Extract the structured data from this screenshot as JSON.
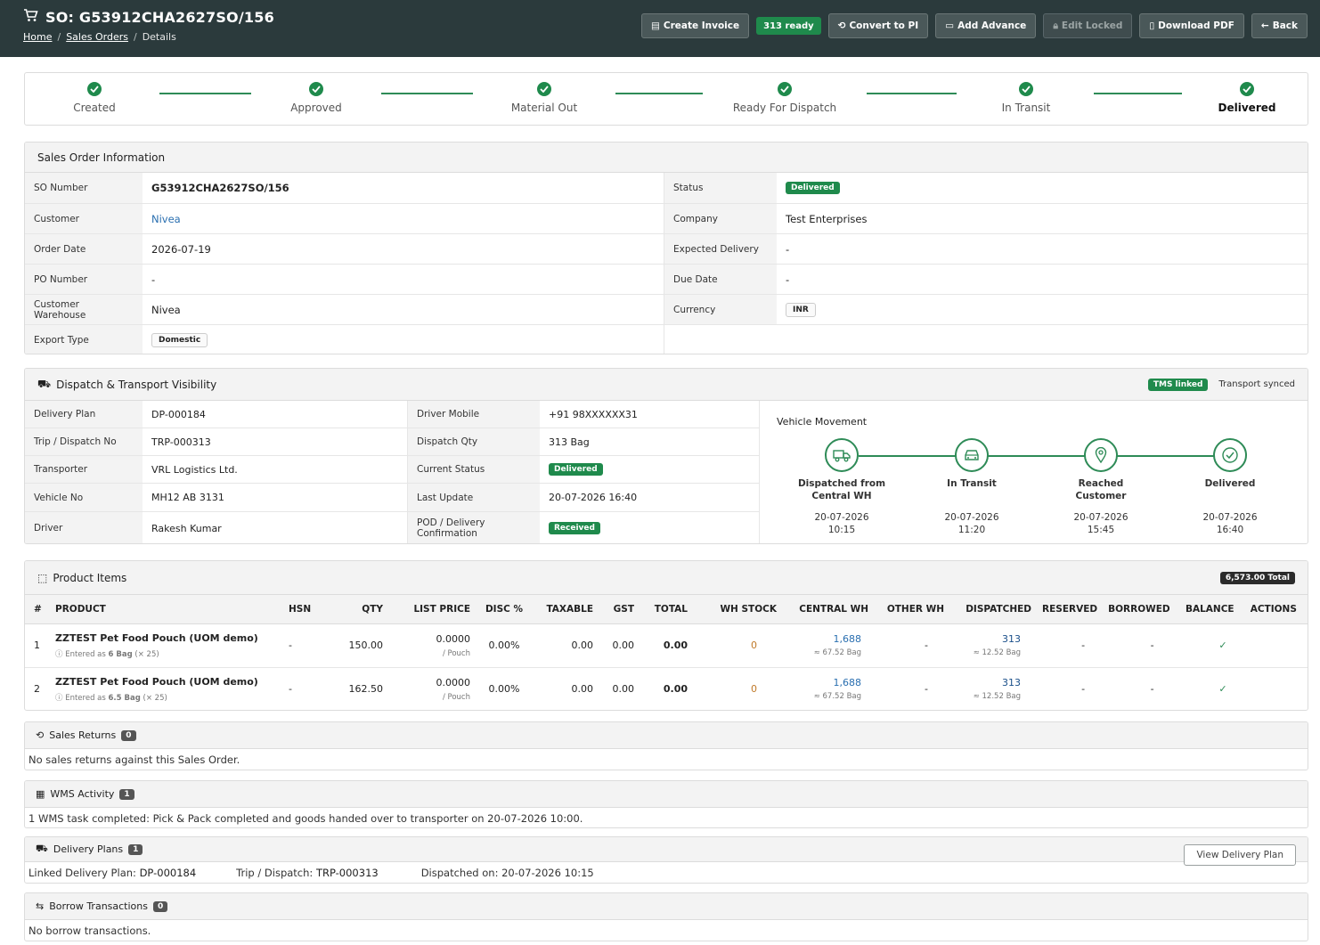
{
  "header": {
    "title": "SO: G53912CHA2627SO/156",
    "breadcrumb": [
      "Home",
      "Sales Orders",
      "Details"
    ],
    "buttons": {
      "create_invoice": "Create Invoice",
      "ready": "313 ready",
      "convert": "Convert to PI",
      "advance": "Add Advance",
      "edit": "Edit Locked",
      "pdf": "Download PDF",
      "back": "Back"
    }
  },
  "steps": [
    "Created",
    "Approved",
    "Material Out",
    "Ready For Dispatch",
    "In Transit",
    "Delivered"
  ],
  "so_info": {
    "title": "Sales Order Information",
    "left": [
      {
        "k": "SO Number",
        "v": "G53912CHA2627SO/156"
      },
      {
        "k": "Customer",
        "v": "Nivea"
      },
      {
        "k": "Order Date",
        "v": "2026-07-19"
      },
      {
        "k": "PO Number",
        "v": "-"
      },
      {
        "k": "Customer Warehouse",
        "v": "Nivea"
      },
      {
        "k": "Export Type",
        "v": "Domestic"
      }
    ],
    "right": [
      {
        "k": "Status",
        "v": "Delivered"
      },
      {
        "k": "Company",
        "v": "Test Enterprises"
      },
      {
        "k": "Expected Delivery",
        "v": "-"
      },
      {
        "k": "Due Date",
        "v": "-"
      },
      {
        "k": "Currency",
        "v": "INR"
      }
    ]
  },
  "dispatch": {
    "title": "Dispatch & Transport Visibility",
    "tms": "TMS linked",
    "synced": "Transport synced",
    "left": [
      {
        "k": "Delivery Plan",
        "v": "DP-000184"
      },
      {
        "k": "Trip / Dispatch No",
        "v": "TRP-000313"
      },
      {
        "k": "Transporter",
        "v": "VRL Logistics Ltd."
      },
      {
        "k": "Vehicle No",
        "v": "MH12 AB 3131"
      },
      {
        "k": "Driver",
        "v": "Rakesh Kumar"
      }
    ],
    "mid": [
      {
        "k": "Driver Mobile",
        "v": "+91 98XXXXXX31"
      },
      {
        "k": "Dispatch Qty",
        "v": "313 Bag"
      },
      {
        "k": "Current Status",
        "v": "Delivered"
      },
      {
        "k": "Last Update",
        "v": "20-07-2026 16:40"
      },
      {
        "k": "POD / Delivery Confirmation",
        "v": "Received"
      }
    ],
    "movement_title": "Vehicle Movement",
    "movement": [
      {
        "label": "Dispatched from Central WH",
        "date": "20-07-2026",
        "time": "10:15",
        "icon": "truck-icon"
      },
      {
        "label": "In Transit",
        "date": "20-07-2026",
        "time": "11:20",
        "icon": "car-icon"
      },
      {
        "label": "Reached Customer",
        "date": "20-07-2026",
        "time": "15:45",
        "icon": "map-pin-icon"
      },
      {
        "label": "Delivered",
        "date": "20-07-2026",
        "time": "16:40",
        "icon": "check-circle-icon"
      }
    ]
  },
  "products": {
    "title": "Product Items",
    "total": "6,573.00 Total",
    "columns": [
      "#",
      "PRODUCT",
      "HSN",
      "QTY",
      "LIST PRICE",
      "DISC %",
      "TAXABLE",
      "GST",
      "TOTAL",
      "WH STOCK",
      "CENTRAL WH",
      "OTHER WH",
      "DISPATCHED",
      "RESERVED",
      "BORROWED",
      "BALANCE",
      "ACTIONS"
    ],
    "rows": [
      {
        "n": "1",
        "name": "ZZTEST Pet Food Pouch (UOM demo)",
        "entered": "Entered as",
        "entered_qty": "6 Bag",
        "entered_mult": "(× 25)",
        "hsn": "-",
        "qty": "150.00",
        "price": "0.0000",
        "per": "/ Pouch",
        "disc": "0.00%",
        "taxable": "0.00",
        "gst": "0.00",
        "total": "0.00",
        "wh": "0",
        "central": "1,688",
        "central_sub": "≈ 67.52 Bag",
        "other": "-",
        "dispatched": "313",
        "dispatched_sub": "≈ 12.52 Bag",
        "reserved": "-",
        "borrowed": "-",
        "balance": "✓"
      },
      {
        "n": "2",
        "name": "ZZTEST Pet Food Pouch (UOM demo)",
        "entered": "Entered as",
        "entered_qty": "6.5 Bag",
        "entered_mult": "(× 25)",
        "hsn": "-",
        "qty": "162.50",
        "price": "0.0000",
        "per": "/ Pouch",
        "disc": "0.00%",
        "taxable": "0.00",
        "gst": "0.00",
        "total": "0.00",
        "wh": "0",
        "central": "1,688",
        "central_sub": "≈ 67.52 Bag",
        "other": "-",
        "dispatched": "313",
        "dispatched_sub": "≈ 12.52 Bag",
        "reserved": "-",
        "borrowed": "-",
        "balance": "✓"
      }
    ]
  },
  "returns": {
    "title": "Sales Returns",
    "count": "0",
    "text": "No sales returns against this Sales Order."
  },
  "wms": {
    "title": "WMS Activity",
    "count": "1",
    "text": "1 WMS task completed: Pick & Pack completed and goods handed over to transporter on 20-07-2026 10:00."
  },
  "plans": {
    "title": "Delivery Plans",
    "count": "1",
    "l1": "Linked Delivery Plan:",
    "v1": "DP-000184",
    "l2": "Trip / Dispatch:",
    "v2": "TRP-000313",
    "l3": "Dispatched on:",
    "v3": "20-07-2026 10:15",
    "button": "View Delivery Plan"
  },
  "borrow": {
    "title": "Borrow Transactions",
    "count": "0",
    "text": "No borrow transactions."
  }
}
